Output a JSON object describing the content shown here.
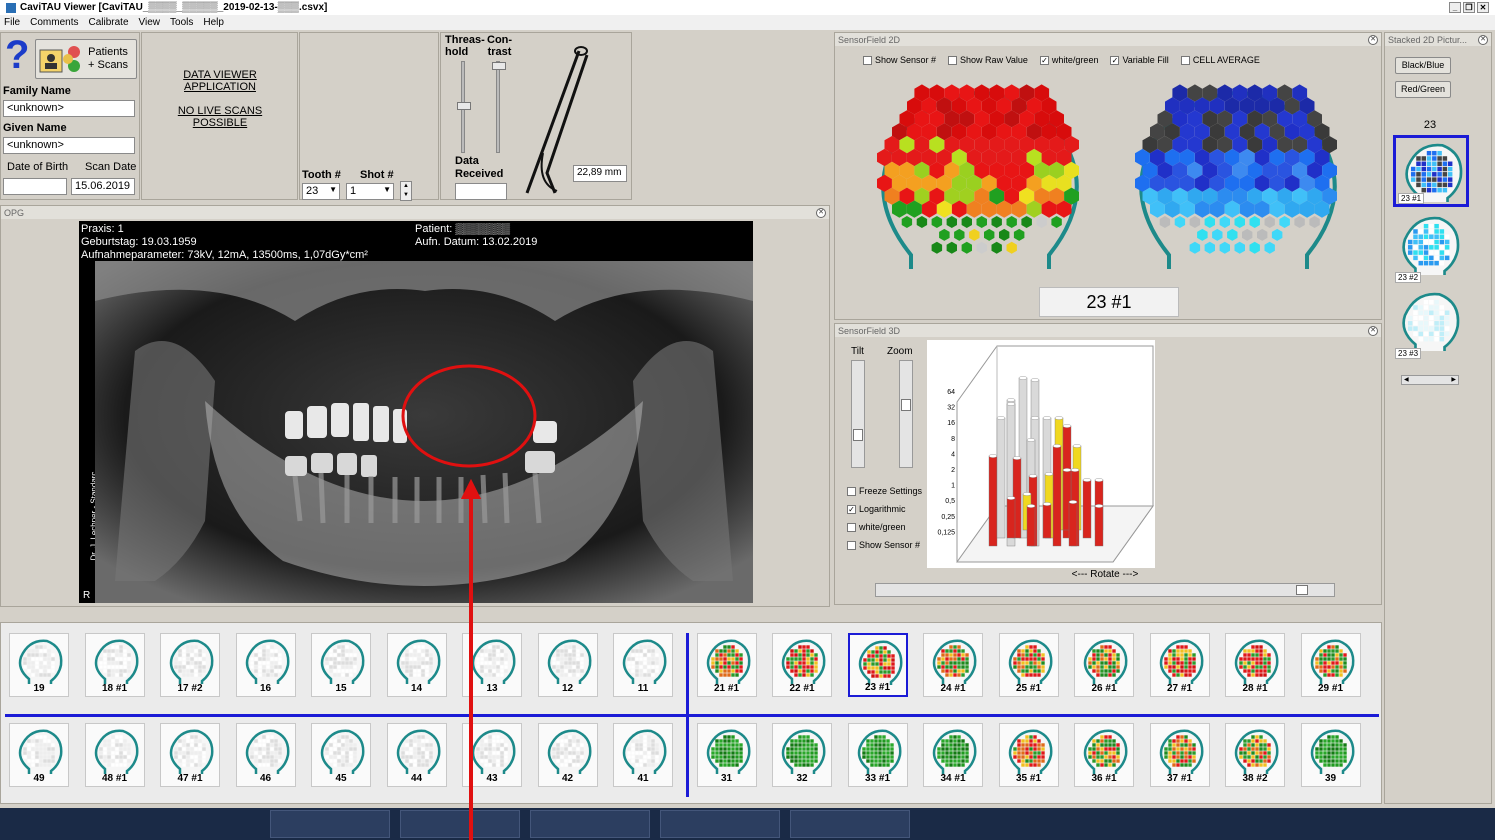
{
  "window": {
    "title": "CaviTAU Viewer [CaviTAU_▒▒▒▒_▒▒▒▒▒_2019-02-13-▒▒▒.csvx]"
  },
  "menu": [
    "File",
    "Comments",
    "Calibrate",
    "View",
    "Tools",
    "Help"
  ],
  "patient": {
    "patients_button": "Patients\n+ Scans",
    "family_name_label": "Family Name",
    "family_name": "<unknown>",
    "given_name_label": "Given Name",
    "given_name": "<unknown>",
    "dob_label": "Date of Birth",
    "dob": "",
    "scan_date_label": "Scan Date",
    "scan_date": "15.06.2019"
  },
  "info": {
    "line1": "DATA VIEWER APPLICATION",
    "line2": "NO LIVE SCANS POSSIBLE"
  },
  "tooth": {
    "label": "Tooth #",
    "value": "23",
    "shot_label": "Shot #",
    "shot_value": "1"
  },
  "sliders": {
    "threshold_label": "Threas-\nhold",
    "contrast_label": "Con-\ntrast",
    "data_received_label": "Data\nReceived",
    "data_received": "",
    "distance": "22,89 mm"
  },
  "opg": {
    "title": "OPG",
    "praxis": "Praxis: 1",
    "geburtstag": "Geburtstag: 19.03.1959",
    "aufnahme": "Aufnahmeparameter: 73kV, 12mA, 13500ms, 1,07dGy*cm²",
    "patient": "Patient: ▒▒▒▒▒▒▒",
    "aufn_datum": "Aufn. Datum: 13.02.2019",
    "side": "Dr. J. Lechner - Standarc",
    "r_mark": "R"
  },
  "sensor2d": {
    "title": "SensorField 2D",
    "options": [
      {
        "label": "Show Sensor #",
        "checked": false
      },
      {
        "label": "Show Raw Value",
        "checked": false
      },
      {
        "label": "white/green",
        "checked": true
      },
      {
        "label": "Variable Fill",
        "checked": true
      },
      {
        "label": "CELL AVERAGE",
        "checked": false
      }
    ],
    "caption": "23 #1"
  },
  "sensor3d": {
    "title": "SensorField 3D",
    "tilt_label": "Tilt",
    "zoom_label": "Zoom",
    "options": [
      {
        "label": "Freeze Settings",
        "checked": false
      },
      {
        "label": "Logarithmic",
        "checked": true
      },
      {
        "label": "white/green",
        "checked": false
      },
      {
        "label": "Show Sensor #",
        "checked": false
      }
    ],
    "axis_ticks": [
      "64",
      "32",
      "16",
      "8",
      "4",
      "2",
      "1",
      "0,5",
      "0,25",
      "0,125"
    ],
    "rotate_label": "<--- Rotate --->"
  },
  "stacked": {
    "title": "Stacked 2D Pictur...",
    "buttons": [
      "Black/Blue",
      "Red/Green"
    ],
    "tooth": "23",
    "items": [
      "23 #1",
      "23 #2",
      "23 #3"
    ]
  },
  "teeth": {
    "upper": [
      {
        "label": "19",
        "type": "white"
      },
      {
        "label": "18 #1",
        "type": "white"
      },
      {
        "label": "17 #2",
        "type": "white"
      },
      {
        "label": "16",
        "type": "white"
      },
      {
        "label": "15",
        "type": "white"
      },
      {
        "label": "14",
        "type": "white"
      },
      {
        "label": "13",
        "type": "white"
      },
      {
        "label": "12",
        "type": "white"
      },
      {
        "label": "11",
        "type": "white"
      },
      {
        "label": "21 #1",
        "type": "mixed"
      },
      {
        "label": "22 #1",
        "type": "red"
      },
      {
        "label": "23 #1",
        "type": "red"
      },
      {
        "label": "24 #1",
        "type": "mixed"
      },
      {
        "label": "25 #1",
        "type": "mixed"
      },
      {
        "label": "26 #1",
        "type": "mixed"
      },
      {
        "label": "27 #1",
        "type": "red"
      },
      {
        "label": "28 #1",
        "type": "red"
      },
      {
        "label": "29 #1",
        "type": "mixed"
      }
    ],
    "lower": [
      {
        "label": "49",
        "type": "white"
      },
      {
        "label": "48 #1",
        "type": "white"
      },
      {
        "label": "47 #1",
        "type": "white"
      },
      {
        "label": "46",
        "type": "white"
      },
      {
        "label": "45",
        "type": "white"
      },
      {
        "label": "44",
        "type": "white"
      },
      {
        "label": "43",
        "type": "white"
      },
      {
        "label": "42",
        "type": "white"
      },
      {
        "label": "41",
        "type": "white"
      },
      {
        "label": "31",
        "type": "green"
      },
      {
        "label": "32",
        "type": "green"
      },
      {
        "label": "33 #1",
        "type": "green"
      },
      {
        "label": "34 #1",
        "type": "green"
      },
      {
        "label": "35 #1",
        "type": "mixed"
      },
      {
        "label": "36 #1",
        "type": "mixed"
      },
      {
        "label": "37 #1",
        "type": "mixed"
      },
      {
        "label": "38 #2",
        "type": "mixed"
      },
      {
        "label": "39",
        "type": "green"
      }
    ],
    "selected": "23 #1"
  },
  "colors": {
    "accent": "#1b1bd6",
    "teal": "#1d8a8a",
    "annotation": "#e01010"
  }
}
